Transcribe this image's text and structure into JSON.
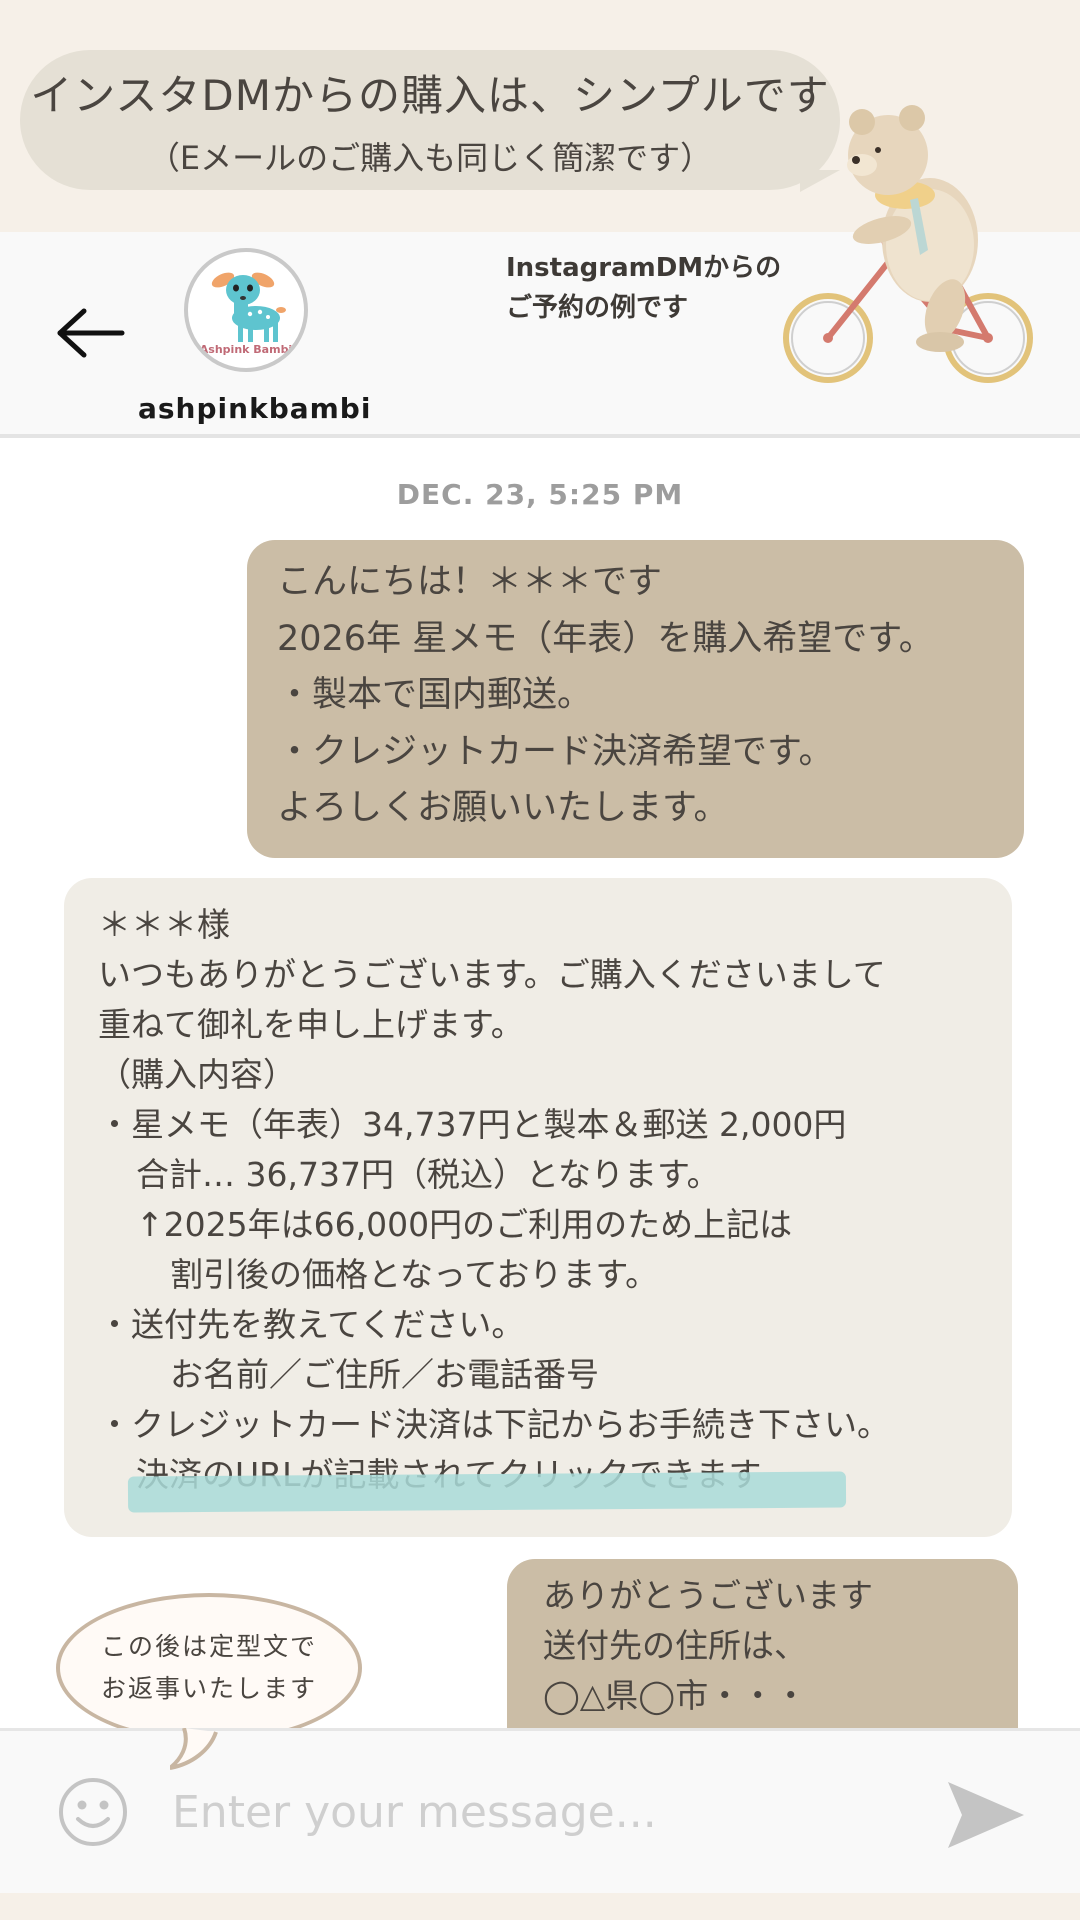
{
  "banner": {
    "title": "インスタDMからの購入は、シンプルです",
    "subtitle": "（Eメールのご購入も同じく簡潔です）"
  },
  "header": {
    "avatar_text": "Ashpink Bambi",
    "username": "ashpinkbambi",
    "note_line1": "InstagramDMからの",
    "note_line2": "ご予約の例です"
  },
  "chat": {
    "date": "DEC. 23, 5:25 PM",
    "messages": [
      {
        "direction": "outgoing",
        "lines": [
          "こんにちは！＊＊＊です",
          "2026年 星メモ（年表）を購入希望です。",
          "・製本で国内郵送。",
          "・クレジットカード決済希望です。",
          "よろしくお願いいたします。"
        ]
      },
      {
        "direction": "incoming",
        "lines": [
          "＊＊＊様",
          "いつもありがとうございます。ご購入くださいまして",
          "重ねて御礼を申し上げます。",
          "（購入内容）",
          "・星メモ（年表）34,737円と製本＆郵送 2,000円",
          "合計… 36,737円（税込）となります。",
          "↑2025年は66,000円のご利用のため上記は",
          "割引後の価格となっております。",
          "・送付先を教えてください。",
          "お名前／ご住所／お電話番号",
          "・クレジットカード決済は下記からお手続き下さい。",
          "決済のURLが記載されてクリックできます"
        ]
      },
      {
        "direction": "outgoing",
        "lines": [
          "ありがとうございます",
          "送付先の住所は、",
          "◯△県◯市・・・"
        ]
      }
    ]
  },
  "note": {
    "line1": "この後は定型文で",
    "line2": "お返事いたします"
  },
  "composer": {
    "placeholder": "Enter your message..."
  },
  "colors": {
    "outgoing_bubble": "#cbbda6",
    "incoming_bubble": "#f0ede6",
    "highlight": "#a9dad8",
    "banner_bg": "#f6f0e8"
  }
}
